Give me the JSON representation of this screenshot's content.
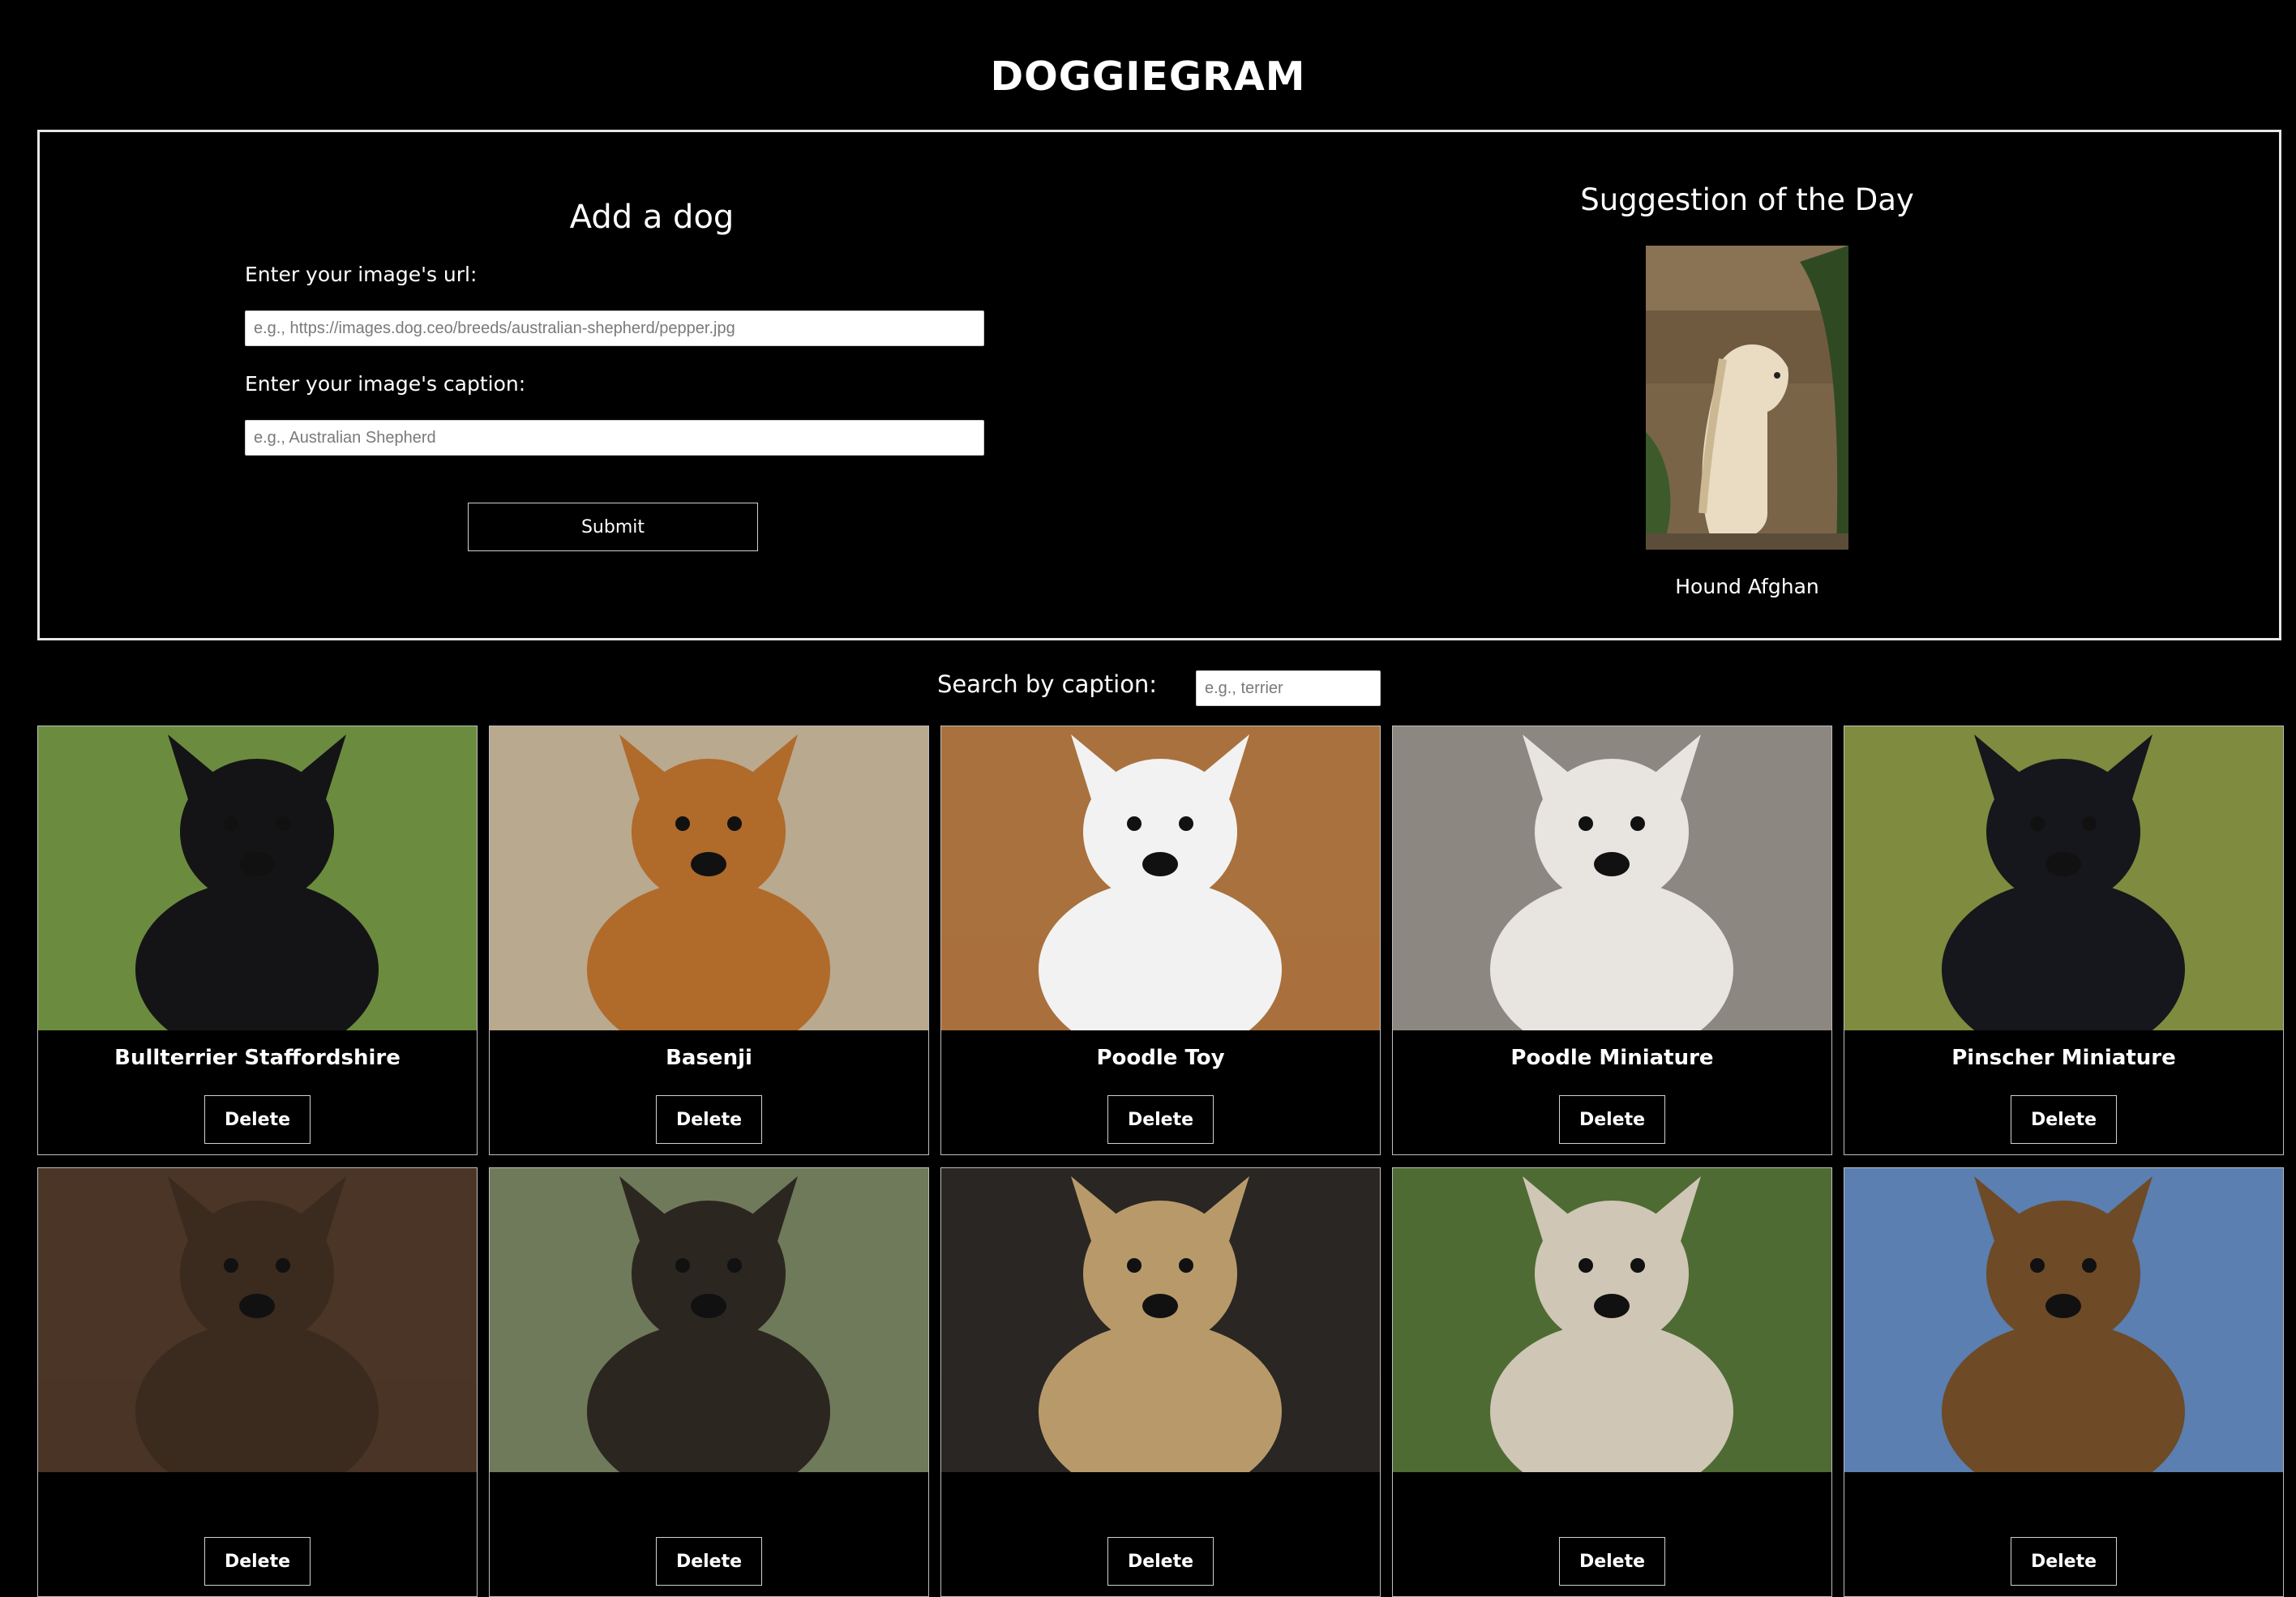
{
  "app": {
    "title": "DOGGIEGRAM"
  },
  "add_form": {
    "heading": "Add a dog",
    "url_label": "Enter your image's url:",
    "url_placeholder": "e.g., https://images.dog.ceo/breeds/australian-shepherd/pepper.jpg",
    "url_value": "",
    "caption_label": "Enter your image's caption:",
    "caption_placeholder": "e.g., Australian Shepherd",
    "caption_value": "",
    "submit_label": "Submit"
  },
  "suggestion": {
    "heading": "Suggestion of the Day",
    "caption": "Hound Afghan",
    "photo_icon": "afghan-hound-photo"
  },
  "search": {
    "label": "Search by caption:",
    "placeholder": "e.g., terrier",
    "value": ""
  },
  "gallery": {
    "cards": [
      {
        "caption": "Bullterrier Staffordshire",
        "delete_label": "Delete",
        "photo_icon": "staffordshire-bullterrier-photo",
        "bg": "#6b8c3e",
        "dog": "#141416"
      },
      {
        "caption": "Basenji",
        "delete_label": "Delete",
        "photo_icon": "basenji-photo",
        "bg": "#b8a98f",
        "dog": "#b06a2a"
      },
      {
        "caption": "Poodle Toy",
        "delete_label": "Delete",
        "photo_icon": "toy-poodle-photo",
        "bg": "#a9713d",
        "dog": "#f2f2f2"
      },
      {
        "caption": "Poodle Miniature",
        "delete_label": "Delete",
        "photo_icon": "miniature-poodle-photo",
        "bg": "#8d8782",
        "dog": "#e8e4e0"
      },
      {
        "caption": "Pinscher Miniature",
        "delete_label": "Delete",
        "photo_icon": "miniature-pinscher-photo",
        "bg": "#7f8b3e",
        "dog": "#15171c"
      },
      {
        "caption": "",
        "delete_label": "Delete",
        "photo_icon": "shepherd-mix-photo",
        "bg": "#4a3526",
        "dog": "#3b2a1e"
      },
      {
        "caption": "",
        "delete_label": "Delete",
        "photo_icon": "terrier-mix-photo",
        "bg": "#6f7a5a",
        "dog": "#2c2620"
      },
      {
        "caption": "",
        "delete_label": "Delete",
        "photo_icon": "shaggy-dog-photo",
        "bg": "#2a2623",
        "dog": "#b89a6a"
      },
      {
        "caption": "",
        "delete_label": "Delete",
        "photo_icon": "fluffy-puppy-photo",
        "bg": "#4e6b33",
        "dog": "#cfc6b6"
      },
      {
        "caption": "",
        "delete_label": "Delete",
        "photo_icon": "yorkshire-terrier-photo",
        "bg": "#5a7fb0",
        "dog": "#6e4a26"
      }
    ]
  }
}
